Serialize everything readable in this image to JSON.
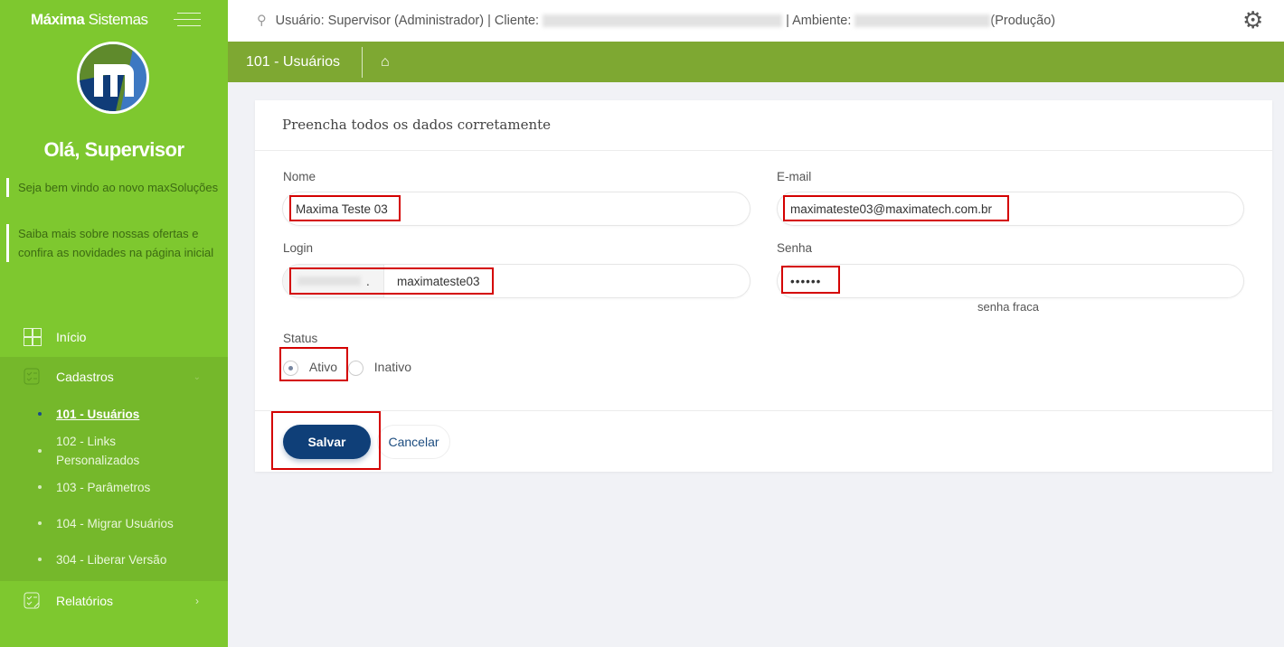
{
  "sidebar": {
    "brand_bold": "Máxima",
    "brand_light": "Sistemas",
    "greeting": "Olá, Supervisor",
    "notes": [
      "Seja bem vindo ao novo maxSoluções",
      "Saiba mais sobre nossas ofertas e confira as novidades na página inicial"
    ],
    "menu": [
      {
        "label": "Início",
        "icon": "grid-icon"
      },
      {
        "label": "Cadastros",
        "icon": "checklist-icon",
        "expanded": true,
        "children": [
          "101 - Usuários",
          "102 - Links Personalizados",
          "103 - Parâmetros",
          "104 - Migrar Usuários",
          "304 - Liberar Versão"
        ],
        "active": "101 - Usuários"
      },
      {
        "label": "Relatórios",
        "icon": "report-icon"
      }
    ]
  },
  "topbar": {
    "user_text": "Usuário: Supervisor (Administrador) | Cliente:",
    "ambiente_label": "| Ambiente:",
    "ambiente_suffix": "(Produção)"
  },
  "page": {
    "breadcrumb": "101 - Usuários"
  },
  "form": {
    "title": "Preencha todos os dados corretamente",
    "nome_label": "Nome",
    "nome_value": "Maxima Teste 03",
    "email_label": "E-mail",
    "email_value": "maximateste03@maximatech.com.br",
    "login_label": "Login",
    "login_prefix": ".",
    "login_value": "maximateste03",
    "senha_label": "Senha",
    "senha_value": "••••••",
    "senha_strength": "senha fraca",
    "status_label": "Status",
    "status_options": [
      "Ativo",
      "Inativo"
    ],
    "status_selected": "Ativo",
    "save": "Salvar",
    "cancel": "Cancelar"
  },
  "colors": {
    "sidebar": "#7ec82f",
    "header": "#7ea832",
    "primary": "#0f3f78",
    "highlight": "#d40000"
  }
}
